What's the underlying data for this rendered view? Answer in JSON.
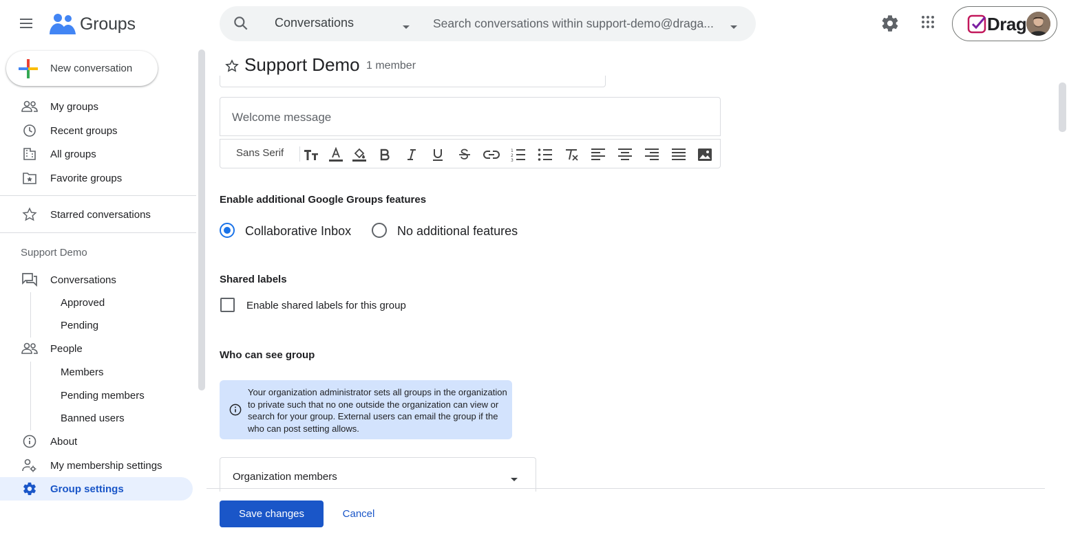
{
  "app": {
    "name": "Groups"
  },
  "search": {
    "scope": "Conversations",
    "placeholder": "Search conversations within support-demo@draga..."
  },
  "account": {
    "brand": "Drag"
  },
  "sidebar": {
    "compose_label": "New conversation",
    "items": [
      {
        "label": "My groups",
        "icon": "people-icon"
      },
      {
        "label": "Recent groups",
        "icon": "clock-icon"
      },
      {
        "label": "All groups",
        "icon": "building-icon"
      },
      {
        "label": "Favorite groups",
        "icon": "star-folder-icon"
      }
    ],
    "starred_label": "Starred conversations",
    "group_section": "Support Demo",
    "conversations": {
      "label": "Conversations",
      "children": [
        "Approved",
        "Pending"
      ]
    },
    "people": {
      "label": "People",
      "children": [
        "Members",
        "Pending members",
        "Banned users"
      ]
    },
    "about_label": "About",
    "membership_label": "My membership settings",
    "settings_label": "Group settings"
  },
  "header": {
    "title": "Support Demo",
    "member_count": "1 member"
  },
  "form": {
    "welcome_placeholder": "Welcome message",
    "toolbar_font": "Sans Serif",
    "features_heading": "Enable additional Google Groups features",
    "features_options": [
      "Collaborative Inbox",
      "No additional features"
    ],
    "features_selected": "Collaborative Inbox",
    "labels_heading": "Shared labels",
    "labels_checkbox": "Enable shared labels for this group",
    "labels_checked": false,
    "visibility_heading": "Who can see group",
    "visibility_info": "Your organization administrator sets all groups in the organization to private such that no one outside the organization can view or search for your group. External users can email the group if the who can post setting allows.",
    "visibility_value": "Organization members"
  },
  "footer": {
    "save_label": "Save changes",
    "cancel_label": "Cancel"
  },
  "colors": {
    "accent": "#1a73e8",
    "primary_button": "#1a56c8",
    "info_bg": "#d3e3fd",
    "active_nav_bg": "#e8f0fe"
  }
}
